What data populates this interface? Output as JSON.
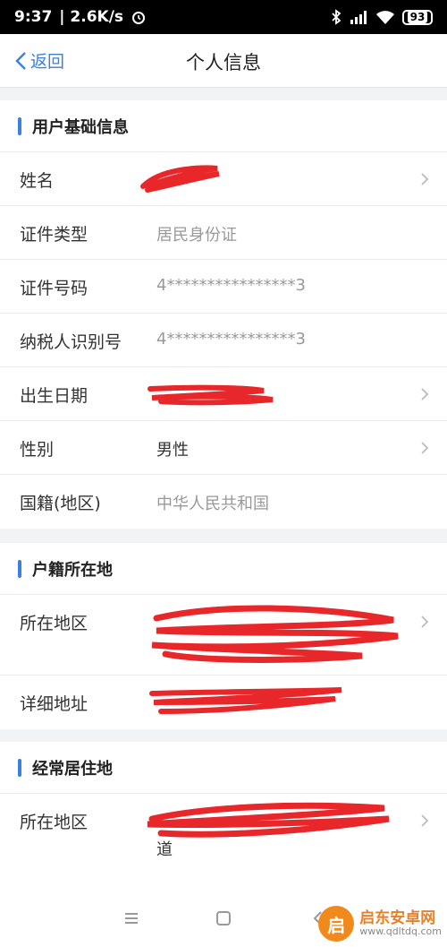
{
  "statusbar": {
    "time": "9:37",
    "speed": "| 2.6K/s",
    "battery": "93"
  },
  "nav": {
    "back_label": "返回",
    "title": "个人信息"
  },
  "basic": {
    "title": "用户基础信息",
    "rows": [
      {
        "label": "姓名",
        "value": ""
      },
      {
        "label": "证件类型",
        "value": "居民身份证"
      },
      {
        "label": "证件号码",
        "value": "4****************3"
      },
      {
        "label": "纳税人识别号",
        "value": "4****************3"
      },
      {
        "label": "出生日期",
        "value": ""
      },
      {
        "label": "性别",
        "value": "男性"
      },
      {
        "label": "国籍(地区)",
        "value": "中华人民共和国"
      }
    ]
  },
  "household": {
    "title": "户籍所在地",
    "rows": [
      {
        "label": "所在地区",
        "value": ""
      },
      {
        "label": "详细地址",
        "value": ""
      }
    ]
  },
  "residence": {
    "title": "经常居住地",
    "rows": [
      {
        "label": "所在地区",
        "value": "道"
      }
    ]
  },
  "watermark": {
    "logo": "启",
    "name": "启东安卓网",
    "url": "www.qdltdq.com"
  },
  "colors": {
    "accent": "#3b7fe0",
    "redaction": "#e8272b"
  }
}
